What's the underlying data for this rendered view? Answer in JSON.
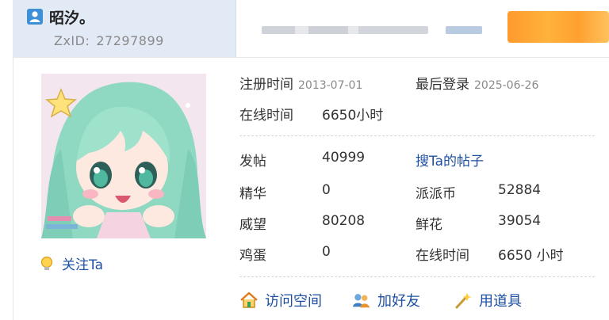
{
  "header": {
    "username": "昭汐。",
    "id_label": "ZxID:",
    "id_value": "27297899"
  },
  "follow": {
    "label": "关注Ta"
  },
  "reg": {
    "reg_label": "注册时间",
    "reg_date": "2013-07-01",
    "last_label": "最后登录",
    "last_date": "2025-06-26",
    "online_label": "在线时间",
    "online_value": "6650小时"
  },
  "stats": {
    "posts_label": "发帖",
    "posts_value": "40999",
    "search_link": "搜Ta的帖子",
    "essence_label": "精华",
    "essence_value": "0",
    "coin_label": "派派币",
    "coin_value": "52884",
    "prestige_label": "威望",
    "prestige_value": "80208",
    "flower_label": "鲜花",
    "flower_value": "39054",
    "egg_label": "鸡蛋",
    "egg_value": "0",
    "online2_label": "在线时间",
    "online2_value": "6650 小时"
  },
  "actions": {
    "visit": "访问空间",
    "add_friend": "加好友",
    "use_item": "用道具"
  },
  "colors": {
    "link": "#1e50a2",
    "header_bg": "#e2eaf6",
    "badge": "#3d8fd6"
  }
}
